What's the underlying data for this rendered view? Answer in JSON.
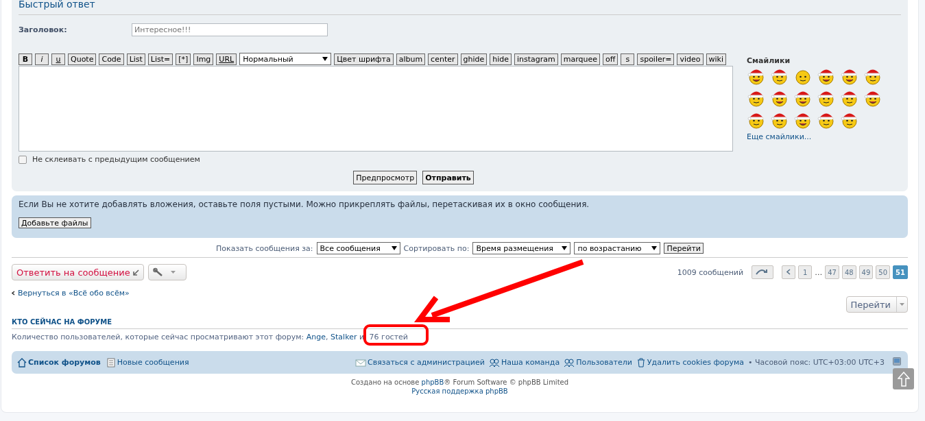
{
  "quick_reply": {
    "title": "Быстрый ответ",
    "subject_label": "Заголовок:",
    "subject_value": "Интересное!!!",
    "toolbar": [
      {
        "label": "B",
        "kind": "bold"
      },
      {
        "label": "i",
        "kind": "italic"
      },
      {
        "label": "u",
        "kind": "underline"
      },
      {
        "label": "Quote",
        "kind": "button"
      },
      {
        "label": "Code",
        "kind": "button"
      },
      {
        "label": "List",
        "kind": "button"
      },
      {
        "label": "List=",
        "kind": "button"
      },
      {
        "label": "[*]",
        "kind": "button"
      },
      {
        "label": "Img",
        "kind": "button"
      },
      {
        "label": "URL",
        "kind": "underline"
      },
      {
        "label": "Нормальный",
        "kind": "select"
      },
      {
        "label": "Цвет шрифта",
        "kind": "button"
      },
      {
        "label": "album",
        "kind": "button"
      },
      {
        "label": "center",
        "kind": "button"
      },
      {
        "label": "ghide",
        "kind": "button"
      },
      {
        "label": "hide",
        "kind": "button"
      },
      {
        "label": "instagram",
        "kind": "button"
      },
      {
        "label": "marquee",
        "kind": "button"
      },
      {
        "label": "off",
        "kind": "button"
      },
      {
        "label": "s",
        "kind": "button"
      },
      {
        "label": "spoiler=",
        "kind": "button"
      },
      {
        "label": "video",
        "kind": "button"
      },
      {
        "label": "wiki",
        "kind": "button"
      }
    ],
    "smilies_title": "Смайлики",
    "more_smilies": "Еще смайлики...",
    "no_merge": {
      "label": "Не склеивать с предыдущим сообщением",
      "checked": false
    },
    "buttons": [
      {
        "label": "Предпросмотр",
        "primary": false
      },
      {
        "label": "Отправить",
        "primary": true
      }
    ]
  },
  "attachments": {
    "text": "Если Вы не хотите добавлять вложения, оставьте поля пустыми. Можно прикреплять файлы, перетаскивая их в окно сообщения.",
    "button": "Добавьте файлы"
  },
  "sorting": {
    "show_label": "Показать сообщения за:",
    "show_value": "Все сообщения",
    "sort_label": "Сортировать по:",
    "sort_value": "Время размещения",
    "order_value": "по возрастанию",
    "go": "Перейти"
  },
  "actions": {
    "reply": "Ответить на сообщение",
    "total": "1009 сообщений",
    "pagination": [
      {
        "kind": "prev",
        "selected": false
      },
      {
        "label": "1",
        "kind": "page",
        "selected": false
      },
      {
        "label": "…",
        "kind": "ellipsis",
        "selected": false
      },
      {
        "label": "47",
        "kind": "page",
        "selected": false
      },
      {
        "label": "48",
        "kind": "page",
        "selected": false
      },
      {
        "label": "49",
        "kind": "page",
        "selected": false
      },
      {
        "label": "50",
        "kind": "page",
        "selected": false
      },
      {
        "label": "51",
        "kind": "page",
        "selected": true
      }
    ]
  },
  "back_link": "Вернуться в «Всё обо всём»",
  "jump": "Перейти",
  "online": {
    "heading": "КТО СЕЙЧАС НА ФОРУМЕ",
    "text": "Количество пользователей, которые сейчас просматривают этот форум:",
    "users": [
      "Ange",
      "Stalker"
    ],
    "separator": ",",
    "rest": "и",
    "guests": "76 гостей"
  },
  "navbar": {
    "left": [
      {
        "label": "Список форумов",
        "bold": true
      },
      {
        "label": "Новые сообщения",
        "bold": false
      }
    ],
    "right": [
      {
        "label": "Связаться с администрацией"
      },
      {
        "label": "Наша команда"
      },
      {
        "label": "Пользователи"
      },
      {
        "label": "Удалить cookies форума"
      }
    ],
    "timezone": "• Часовой пояс: UTC+03:00 UTC+3"
  },
  "footer": {
    "line1_before": "Создано на основе",
    "line1_link": "phpBB",
    "line1_after": "® Forum Software © phpBB Limited",
    "line2": "Русская поддержка phpBB"
  }
}
